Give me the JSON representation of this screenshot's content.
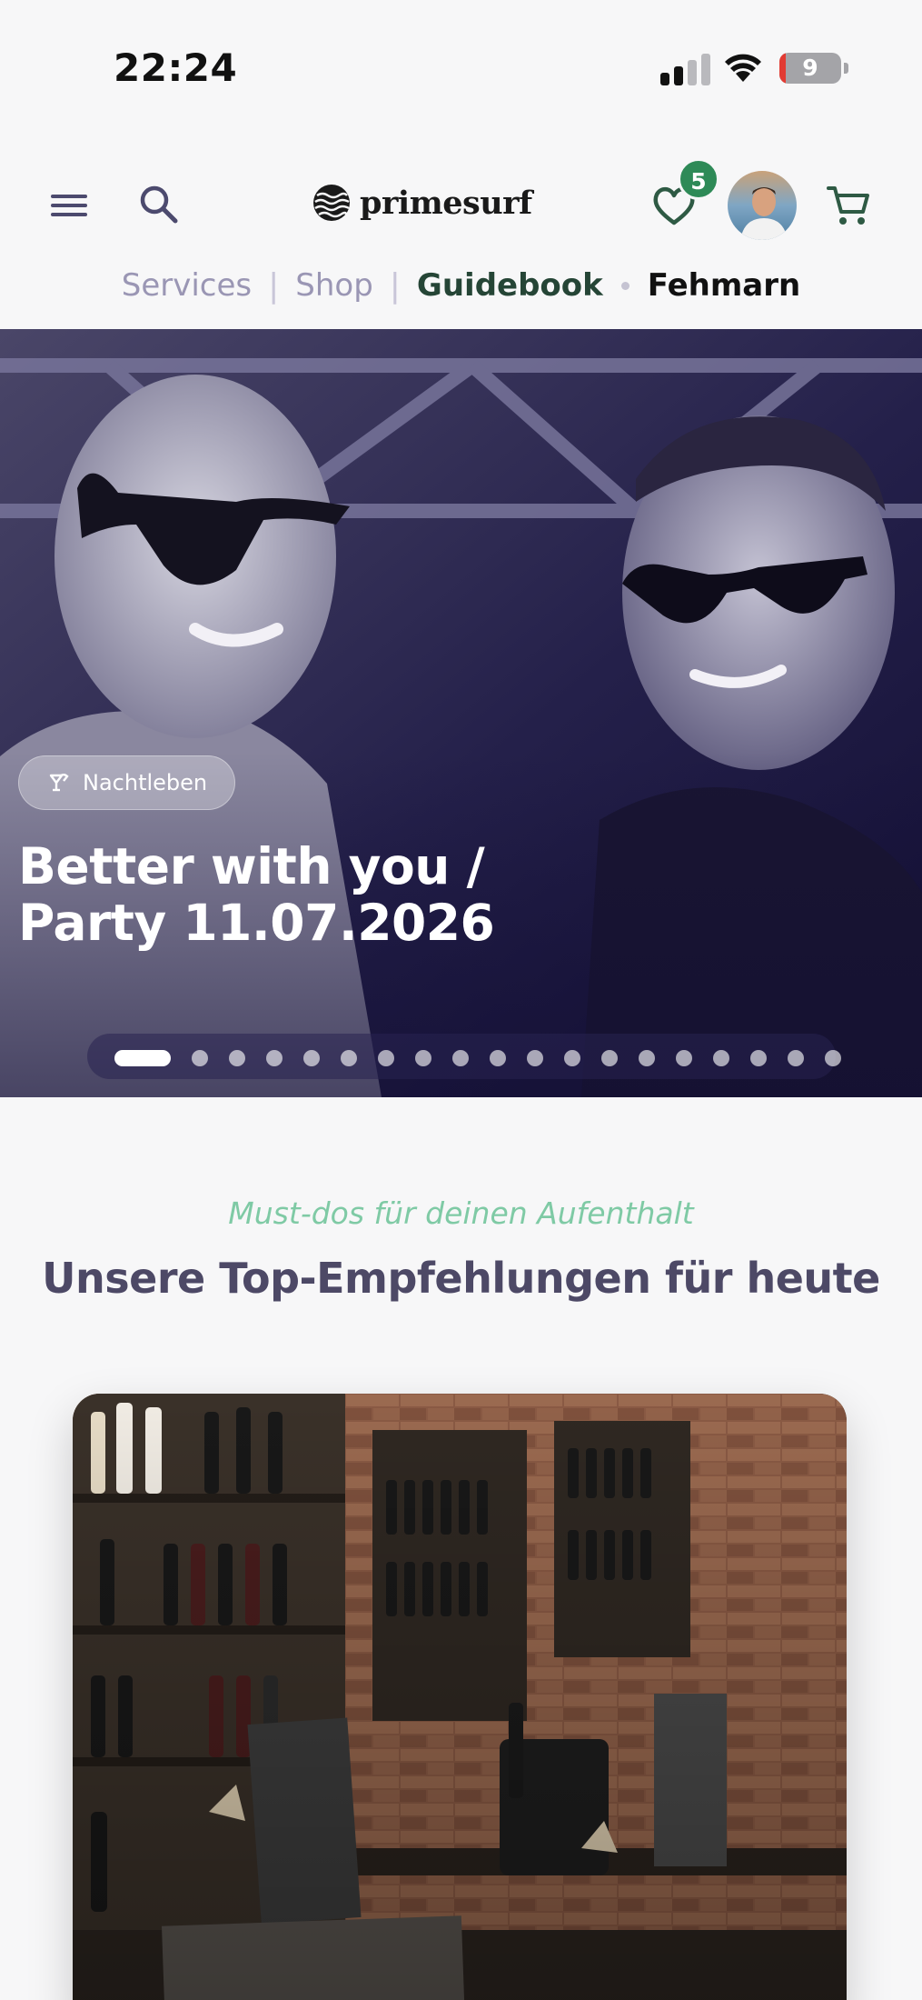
{
  "status_bar": {
    "time": "22:24",
    "battery_level": "9",
    "signal_bars_active": 2,
    "signal_bars_total": 4
  },
  "header": {
    "logo_text": "primesurf",
    "wishlist_count": "5",
    "icons": [
      "menu-icon",
      "search-icon",
      "heart-icon",
      "avatar",
      "cart-icon"
    ]
  },
  "nav": {
    "services": "Services",
    "separator": "|",
    "shop": "Shop",
    "guidebook": "Guidebook",
    "location": "Fehmarn"
  },
  "hero": {
    "category": "Nachtleben",
    "category_icon": "cocktail-icon",
    "title_line1": "Better with you /",
    "title_line2": "Party 11.07.2026",
    "slide_count": 19,
    "active_slide": 1
  },
  "section": {
    "kicker": "Must-dos für deinen Aufenthalt",
    "title": "Unsere Top-Empfehlungen für heute"
  },
  "colors": {
    "accent_green": "#2e8a57",
    "nav_active": "#254536",
    "nav_muted": "#9a96b4",
    "kicker": "#7fcaa5",
    "title": "#4d4966"
  }
}
